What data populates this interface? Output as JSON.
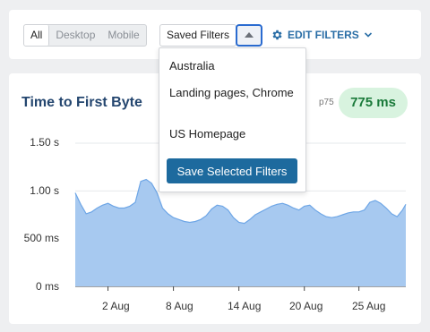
{
  "toolbar": {
    "device_segments": [
      {
        "label": "All",
        "active": true
      },
      {
        "label": "Desktop",
        "active": false
      },
      {
        "label": "Mobile",
        "active": false
      }
    ],
    "saved_filters_label": "Saved Filters",
    "edit_filters_label": "EDIT FILTERS",
    "icons": {
      "gear": "gear-icon",
      "chevron": "chevron-down-icon",
      "toggle": "triangle-up-icon"
    }
  },
  "dropdown": {
    "items": [
      "Australia",
      "Landing pages, Chrome",
      "US Homepage"
    ],
    "save_button_label": "Save Selected Filters"
  },
  "metric": {
    "title": "Time to First Byte",
    "percentile_label": "p75",
    "value_label": "775 ms"
  },
  "colors": {
    "accent": "#2a6ea6",
    "title": "#24466f",
    "badge_bg": "#d8f3df",
    "badge_text": "#1a7a3a",
    "area_fill": "#a7c9f0",
    "area_stroke": "#6ea6e6"
  },
  "chart_data": {
    "type": "area",
    "yticks": [
      "1.50 s",
      "1.00 s",
      "500 ms",
      "0 ms"
    ],
    "ytick_values": [
      1.5,
      1.0,
      0.5,
      0
    ],
    "xticks": [
      "2 Aug",
      "8 Aug",
      "14 Aug",
      "20 Aug",
      "25 Aug"
    ],
    "xtick_values": [
      3,
      9,
      15,
      21,
      26
    ],
    "xlim": [
      0,
      30.3
    ],
    "ylim": [
      0,
      1.5
    ],
    "x": [
      0,
      0.5,
      1,
      1.5,
      2,
      2.5,
      3,
      3.5,
      4,
      4.5,
      5,
      5.5,
      6,
      6.5,
      7,
      7.5,
      8,
      8.5,
      9,
      9.5,
      10,
      10.5,
      11,
      11.5,
      12,
      12.5,
      13,
      13.5,
      14,
      14.5,
      15,
      15.5,
      16,
      16.5,
      17,
      17.5,
      18,
      18.5,
      19,
      19.5,
      20,
      20.5,
      21,
      21.5,
      22,
      22.5,
      23,
      23.5,
      24,
      24.5,
      25,
      25.5,
      26,
      26.5,
      27,
      27.5,
      28,
      28.5,
      29,
      29.5,
      30,
      30.3
    ],
    "y": [
      0.98,
      0.86,
      0.76,
      0.78,
      0.82,
      0.85,
      0.87,
      0.84,
      0.82,
      0.82,
      0.84,
      0.88,
      1.1,
      1.12,
      1.08,
      0.98,
      0.82,
      0.76,
      0.72,
      0.7,
      0.68,
      0.67,
      0.68,
      0.7,
      0.74,
      0.81,
      0.85,
      0.84,
      0.8,
      0.72,
      0.67,
      0.66,
      0.7,
      0.75,
      0.78,
      0.81,
      0.84,
      0.86,
      0.87,
      0.85,
      0.82,
      0.8,
      0.84,
      0.85,
      0.8,
      0.76,
      0.73,
      0.72,
      0.73,
      0.75,
      0.77,
      0.78,
      0.78,
      0.8,
      0.88,
      0.9,
      0.87,
      0.82,
      0.76,
      0.73,
      0.8,
      0.86
    ]
  }
}
